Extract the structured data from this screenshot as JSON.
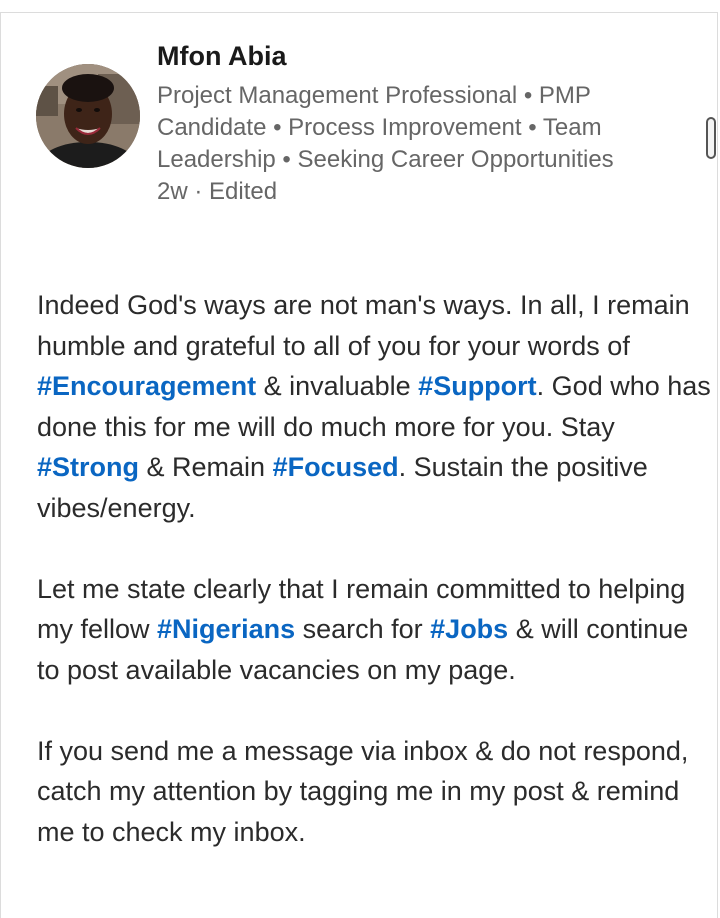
{
  "post": {
    "author": {
      "name": "Mfon Abia",
      "headline": "Project Management Professional • PMP Candidate • Process Improvement • Team Leadership • Seeking Career Opportunities",
      "meta": "2w · Edited"
    },
    "paragraphs": [
      {
        "t1": "Indeed God's ways are not man's ways. In all, I remain humble and grateful to all of you for your words of ",
        "h1": "#Encouragement",
        "t2": " & invaluable ",
        "h2": "#Support",
        "t3": ". God who has done this for me will do much more for you. Stay ",
        "h3": "#Strong",
        "t4": " & Remain ",
        "h4": "#Focused",
        "t5": ". Sustain the positive vibes/energy."
      },
      {
        "t1": "Let me state clearly that I remain committed to helping my fellow ",
        "h1": "#Nigerians",
        "t2": " search for ",
        "h2": "#Jobs",
        "t3": " & will continue to post available vacancies on my page."
      },
      {
        "t1": "If you send me a message via inbox &  do not respond, catch my attention by tagging me in my post & remind me to check my inbox."
      }
    ]
  },
  "colors": {
    "hashtag": "#0a66c2",
    "secondary_text": "#666666",
    "body_text": "#2b2b2b"
  },
  "icons": {
    "scrollbar": "scrollbar-thumb"
  }
}
